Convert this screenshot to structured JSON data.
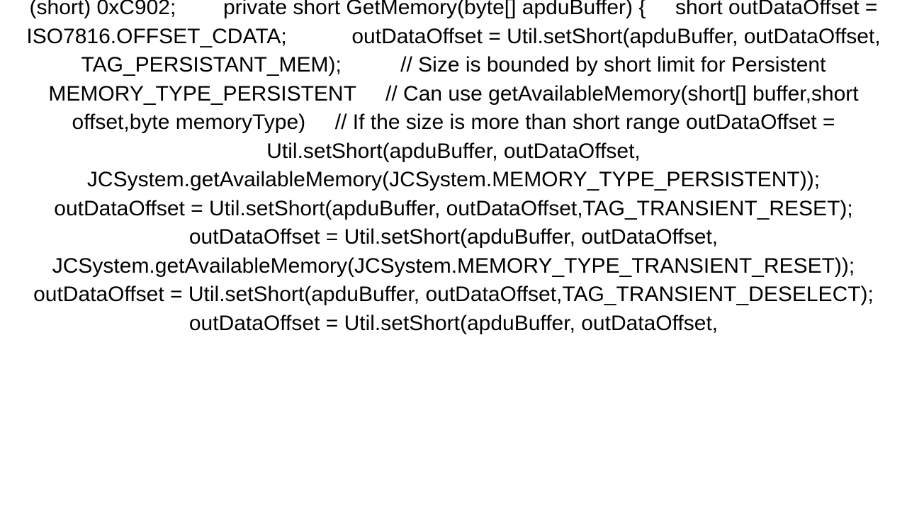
{
  "document": {
    "kind": "code-text-fragment",
    "language": "Java Card",
    "background_color": "#ffffff",
    "text_color": "#000000",
    "alignment": "center",
    "font_size_px": 30,
    "line_height_px": 40.5,
    "first_line_clipped_top": true,
    "last_line_clipped_bottom": true,
    "lines": [
      "(short) 0xC902;        private short GetMemory(byte[]",
      "apduBuffer) {     short outDataOffset =",
      "ISO7816.OFFSET_CDATA;           outDataOffset =",
      "Util.setShort(apduBuffer, outDataOffset,",
      "TAG_PERSISTANT_MEM);          // Size is bounded by",
      "short limit for Persistent MEMORY_TYPE_PERSISTENT     // Can",
      "use getAvailableMemory(short[] buffer,short offset,byte",
      "memoryType)     // If the size is more than short range",
      "outDataOffset = Util.setShort(apduBuffer, outDataOffset,",
      "JCSystem.getAvailableMemory(JCSystem.MEMORY_TYPE_PERSISTENT)",
      ");            outDataOffset = Util.setShort(apduBuffer,",
      "outDataOffset,TAG_TRANSIENT_RESET);",
      "outDataOffset = Util.setShort(apduBuffer, outDataOffset,",
      "JCSystem.getAvailableMemory(JCSystem.MEMORY_TYPE_TRANSIENT_RESET));          outDataOffset =",
      "Util.setShort(apduBuffer,",
      "outDataOffset,TAG_TRANSIENT_DESELECT);",
      "outDataOffset = Util.setShort(apduBuffer, outDataOffset,"
    ],
    "full_text": "(short) 0xC902;        private short GetMemory(byte[] apduBuffer) {     short outDataOffset = ISO7816.OFFSET_CDATA;           outDataOffset = Util.setShort(apduBuffer, outDataOffset, TAG_PERSISTANT_MEM);          // Size is bounded by short limit for Persistent MEMORY_TYPE_PERSISTENT     // Can use getAvailableMemory(short[] buffer,short offset,byte memoryType)     // If the size is more than short range outDataOffset = Util.setShort(apduBuffer, outDataOffset, JCSystem.getAvailableMemory(JCSystem.MEMORY_TYPE_PERSISTENT));            outDataOffset = Util.setShort(apduBuffer, outDataOffset,TAG_TRANSIENT_RESET); outDataOffset = Util.setShort(apduBuffer, outDataOffset, JCSystem.getAvailableMemory(JCSystem.MEMORY_TYPE_TRANSIENT_RESET));          outDataOffset = Util.setShort(apduBuffer, outDataOffset,TAG_TRANSIENT_DESELECT); outDataOffset = Util.setShort(apduBuffer, outDataOffset,"
  }
}
